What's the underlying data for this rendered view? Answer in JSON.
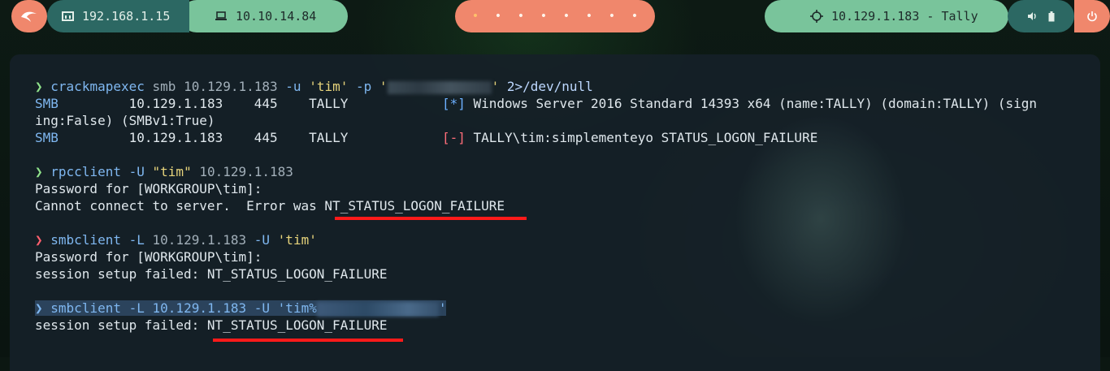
{
  "topbar": {
    "left_ip": "192.168.1.15",
    "vpn_ip": "10.10.14.84",
    "workspaces": [
      "•",
      "•",
      "•",
      "•",
      "•",
      "•",
      "•",
      "•",
      "•",
      "•"
    ],
    "target": "10.129.1.183 - Tally"
  },
  "terminal": {
    "prompt_symbol": "❯",
    "cmd1": {
      "tool": "crackmapexec",
      "sub": "smb",
      "host": "10.129.1.183",
      "u_flag": "-u",
      "user": "'tim'",
      "p_flag": "-p",
      "pass_open": "'",
      "pass_close": "'",
      "redir": "2>/dev/null"
    },
    "cmd1_out": [
      {
        "proto": "SMB",
        "ip": "10.129.1.183",
        "port": "445",
        "name": "TALLY",
        "tag": "[*]",
        "msg": "Windows Server 2016 Standard 14393 x64 (name:TALLY) (domain:TALLY) (sign"
      },
      {
        "wrap": "ing:False) (SMBv1:True)"
      },
      {
        "proto": "SMB",
        "ip": "10.129.1.183",
        "port": "445",
        "name": "TALLY",
        "tag": "[-]",
        "msg": "TALLY\\tim:simplementeyo STATUS_LOGON_FAILURE"
      }
    ],
    "cmd2": {
      "tool": "rpcclient",
      "flag": "-U",
      "user": "\"tim\"",
      "host": "10.129.1.183"
    },
    "cmd2_out1": "Password for [WORKGROUP\\tim]:",
    "cmd2_out2_prefix": "Cannot connect to server.  Error was ",
    "cmd2_out2_status": "NT_STATUS_LOGON_FAILURE",
    "cmd3": {
      "tool": "smbclient",
      "flag": "-L",
      "host": "10.129.1.183",
      "u_flag": "-U",
      "user": "'tim'"
    },
    "cmd3_out1": "Password for [WORKGROUP\\tim]:",
    "cmd3_out2": "session setup failed: NT_STATUS_LOGON_FAILURE",
    "cmd4": {
      "tool": "smbclient",
      "flag": "-L",
      "host": "10.129.1.183",
      "u_flag": "-U",
      "user_open": "'tim%",
      "user_close": "'"
    },
    "cmd4_out_prefix": "session setup failed: ",
    "cmd4_out_status": "NT_STATUS_LOGON_FAILURE"
  },
  "colors": {
    "accent_salmon": "#f0876c",
    "accent_green": "#79c49b",
    "teal": "#2c6863",
    "underline_red": "#ff1a1a"
  }
}
